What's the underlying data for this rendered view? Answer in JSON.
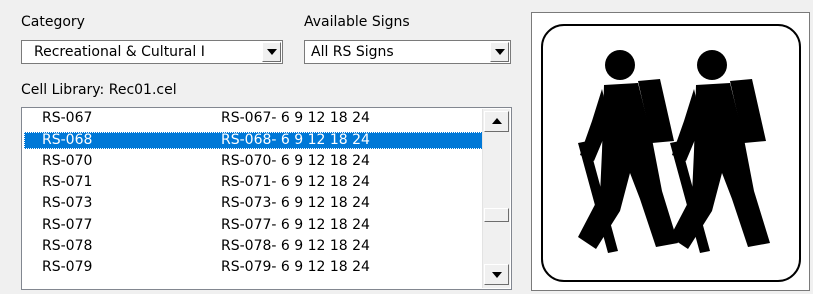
{
  "category": {
    "label": "Category",
    "selected": "Recreational & Cultural I"
  },
  "available_signs": {
    "label": "Available Signs",
    "selected": "All RS Signs"
  },
  "cell_library": {
    "label": "Cell Library:",
    "value": "Rec01.cel"
  },
  "sign_list": {
    "selected_index": 1,
    "rows": [
      {
        "code": "RS-067",
        "desc": "RS-067- 6 9 12 18 24"
      },
      {
        "code": "RS-068",
        "desc": "RS-068- 6 9 12 18 24"
      },
      {
        "code": "RS-070",
        "desc": "RS-070- 6 9 12 18 24"
      },
      {
        "code": "RS-071",
        "desc": "RS-071- 6 9 12 18 24"
      },
      {
        "code": "RS-073",
        "desc": "RS-073- 6 9 12 18 24"
      },
      {
        "code": "RS-077",
        "desc": "RS-077- 6 9 12 18 24"
      },
      {
        "code": "RS-078",
        "desc": "RS-078- 6 9 12 18 24"
      },
      {
        "code": "RS-079",
        "desc": "RS-079- 6 9 12 18 24"
      }
    ]
  },
  "preview": {
    "icon": "hiking-trail-sign-icon",
    "colors": {
      "figure": "#000000",
      "background": "#ffffff",
      "selection": "#0078d7"
    }
  }
}
